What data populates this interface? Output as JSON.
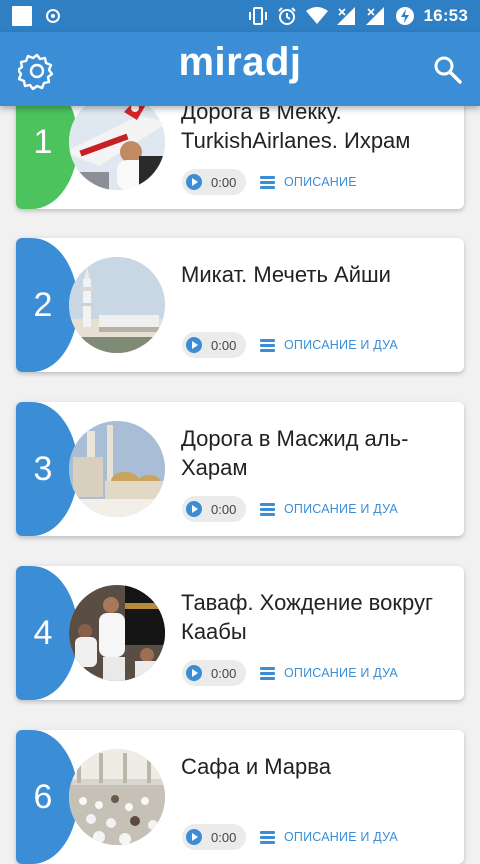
{
  "status_bar": {
    "time": "16:53",
    "icons": [
      "notification-square-icon",
      "record-icon",
      "vibrate-icon",
      "alarm-icon",
      "wifi-icon",
      "signal-icon",
      "signal-icon",
      "battery-charging-icon"
    ]
  },
  "app_bar": {
    "title": "miradj",
    "left_icon": "gear-icon",
    "right_icon": "search-icon"
  },
  "colors": {
    "accent": "#3b8ed6",
    "green": "#4cc35d",
    "status_bar": "#2f7fc4"
  },
  "items": [
    {
      "number": "1",
      "title": "Дорога в Мекку. TurkishAirlanes. Ихрам",
      "time": "0:00",
      "desc": "ОПИСАНИЕ",
      "tab_color": "#4cc35d"
    },
    {
      "number": "2",
      "title": "Микат. Мечеть Айши",
      "time": "0:00",
      "desc": "ОПИСАНИЕ И ДУА",
      "tab_color": "#3b8ed6"
    },
    {
      "number": "3",
      "title": "Дорога в Масжид аль-Харам",
      "time": "0:00",
      "desc": "ОПИСАНИЕ И ДУА",
      "tab_color": "#3b8ed6"
    },
    {
      "number": "4",
      "title": "Таваф. Хождение вокруг Каабы",
      "time": "0:00",
      "desc": "ОПИСАНИЕ И ДУА",
      "tab_color": "#3b8ed6"
    },
    {
      "number": "6",
      "title": "Сафа и Марва",
      "time": "0:00",
      "desc": "ОПИСАНИЕ И ДУА",
      "tab_color": "#3b8ed6"
    }
  ]
}
